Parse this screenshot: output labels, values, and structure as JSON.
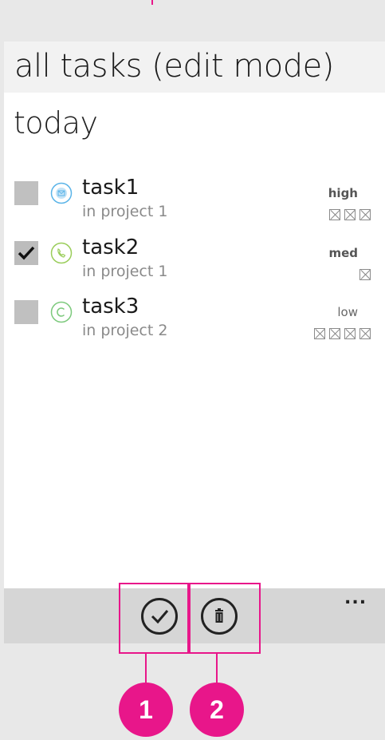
{
  "header": {
    "title": "all tasks (edit mode)"
  },
  "section": {
    "title": "today"
  },
  "tasks": [
    {
      "name": "task1",
      "project": "in project 1",
      "priority": "high",
      "checked": false,
      "icon": "mail-icon",
      "tag_count": 3
    },
    {
      "name": "task2",
      "project": "in project 1",
      "priority": "med",
      "checked": true,
      "icon": "phone-icon",
      "tag_count": 1
    },
    {
      "name": "task3",
      "project": "in project 2",
      "priority": "low",
      "checked": false,
      "icon": "contact-icon",
      "tag_count": 4
    }
  ],
  "app_bar": {
    "more": "...",
    "buttons": [
      {
        "name": "complete",
        "icon": "check-circle-icon"
      },
      {
        "name": "delete",
        "icon": "trash-circle-icon"
      }
    ]
  },
  "callouts": [
    "1",
    "2"
  ],
  "colors": {
    "accent": "#e8168a",
    "mail_icon": "#5ab4e8",
    "phone_icon": "#9acd5a",
    "contact_icon": "#7cc97c"
  }
}
